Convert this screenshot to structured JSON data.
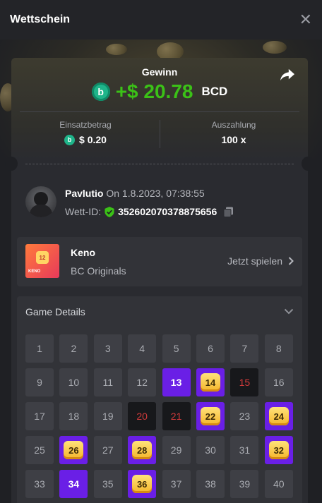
{
  "header": {
    "title": "Wettschein",
    "close_symbol": "✕"
  },
  "result": {
    "label": "Gewinn",
    "amount": "+$ 20.78",
    "currency": "BCD",
    "coin_symbol": "b"
  },
  "stats": {
    "bet_label": "Einsatzbetrag",
    "bet_value": "$ 0.20",
    "payout_label": "Auszahlung",
    "payout_value": "100 x"
  },
  "user": {
    "name": "Pavlutio",
    "date": "On 1.8.2023, 07:38:55",
    "bet_id_label": "Wett-ID:",
    "bet_id": "352602070378875656"
  },
  "game": {
    "name": "Keno",
    "provider": "BC Originals",
    "play_label": "Jetzt spielen",
    "thumb_number": "12",
    "thumb_text": "KENO"
  },
  "details": {
    "title": "Game Details",
    "cells": [
      {
        "n": "1",
        "s": "normal"
      },
      {
        "n": "2",
        "s": "normal"
      },
      {
        "n": "3",
        "s": "normal"
      },
      {
        "n": "4",
        "s": "normal"
      },
      {
        "n": "5",
        "s": "normal"
      },
      {
        "n": "6",
        "s": "normal"
      },
      {
        "n": "7",
        "s": "normal"
      },
      {
        "n": "8",
        "s": "normal"
      },
      {
        "n": "9",
        "s": "normal"
      },
      {
        "n": "10",
        "s": "normal"
      },
      {
        "n": "11",
        "s": "normal"
      },
      {
        "n": "12",
        "s": "normal"
      },
      {
        "n": "13",
        "s": "hit"
      },
      {
        "n": "14",
        "s": "match"
      },
      {
        "n": "15",
        "s": "miss"
      },
      {
        "n": "16",
        "s": "normal"
      },
      {
        "n": "17",
        "s": "normal"
      },
      {
        "n": "18",
        "s": "normal"
      },
      {
        "n": "19",
        "s": "normal"
      },
      {
        "n": "20",
        "s": "miss"
      },
      {
        "n": "21",
        "s": "miss"
      },
      {
        "n": "22",
        "s": "match"
      },
      {
        "n": "23",
        "s": "normal"
      },
      {
        "n": "24",
        "s": "match"
      },
      {
        "n": "25",
        "s": "normal"
      },
      {
        "n": "26",
        "s": "match"
      },
      {
        "n": "27",
        "s": "normal"
      },
      {
        "n": "28",
        "s": "match"
      },
      {
        "n": "29",
        "s": "normal"
      },
      {
        "n": "30",
        "s": "normal"
      },
      {
        "n": "31",
        "s": "normal"
      },
      {
        "n": "32",
        "s": "match"
      },
      {
        "n": "33",
        "s": "normal"
      },
      {
        "n": "34",
        "s": "hit"
      },
      {
        "n": "35",
        "s": "normal"
      },
      {
        "n": "36",
        "s": "match"
      },
      {
        "n": "37",
        "s": "normal"
      },
      {
        "n": "38",
        "s": "normal"
      },
      {
        "n": "39",
        "s": "normal"
      },
      {
        "n": "40",
        "s": "normal"
      }
    ]
  },
  "colors": {
    "win_green": "#3bc117",
    "selected_purple": "#6a1fe6",
    "miss_red": "#d23b3b",
    "gem_gold": "#f4b52a"
  },
  "icons": [
    "close-icon",
    "share-icon",
    "bc-coin-icon",
    "shield-check-icon",
    "copy-icon",
    "chevron-right-icon",
    "chevron-down-icon"
  ]
}
